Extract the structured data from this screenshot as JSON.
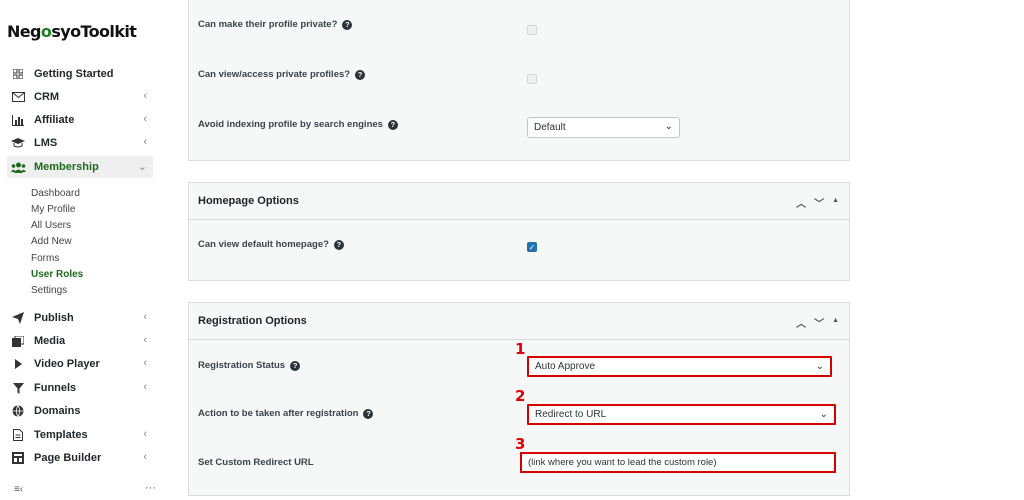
{
  "logo": {
    "part1": "Neg",
    "part2": "o",
    "part3": "syoToolkit"
  },
  "nav": [
    {
      "label": "Getting Started",
      "icon": "grid-icon",
      "chevron": ""
    },
    {
      "label": "CRM",
      "icon": "mail-icon",
      "chevron": "‹"
    },
    {
      "label": "Affiliate",
      "icon": "bar-chart-icon",
      "chevron": "‹"
    },
    {
      "label": "LMS",
      "icon": "graduation-cap-icon",
      "chevron": "‹"
    },
    {
      "label": "Membership",
      "icon": "users-icon",
      "chevron": "⌄"
    },
    {
      "label": "Publish",
      "icon": "paper-plane-icon",
      "chevron": "‹"
    },
    {
      "label": "Media",
      "icon": "media-icon",
      "chevron": "‹"
    },
    {
      "label": "Video Player",
      "icon": "video-icon",
      "chevron": "‹"
    },
    {
      "label": "Funnels",
      "icon": "funnel-icon",
      "chevron": "‹"
    },
    {
      "label": "Domains",
      "icon": "globe-icon",
      "chevron": ""
    },
    {
      "label": "Templates",
      "icon": "document-icon",
      "chevron": "‹"
    },
    {
      "label": "Page Builder",
      "icon": "page-builder-icon",
      "chevron": "‹"
    }
  ],
  "membership_sub": [
    "Dashboard",
    "My Profile",
    "All Users",
    "Add New",
    "Forms",
    "User Roles",
    "Settings"
  ],
  "sidebar_bottom": {
    "collapse": "≡‹",
    "more": "···"
  },
  "profile_panel": {
    "rows": [
      {
        "label": "Can make their profile private?"
      },
      {
        "label": "Can view/access private profiles?"
      },
      {
        "label": "Avoid indexing profile by search engines"
      }
    ],
    "indexing_select": "Default"
  },
  "homepage_panel": {
    "title": "Homepage Options",
    "row_label": "Can view default homepage?"
  },
  "registration_panel": {
    "title": "Registration Options",
    "status_label": "Registration Status",
    "status_value": "Auto Approve",
    "action_label": "Action to be taken after registration",
    "action_value": "Redirect to URL",
    "redirect_label": "Set Custom Redirect URL",
    "redirect_value": "(link where you want to lead the custom role)"
  },
  "markers": [
    "1",
    "2",
    "3"
  ],
  "panel_controls": {
    "up": "︿",
    "down": "﹀",
    "toggle": "▲"
  }
}
